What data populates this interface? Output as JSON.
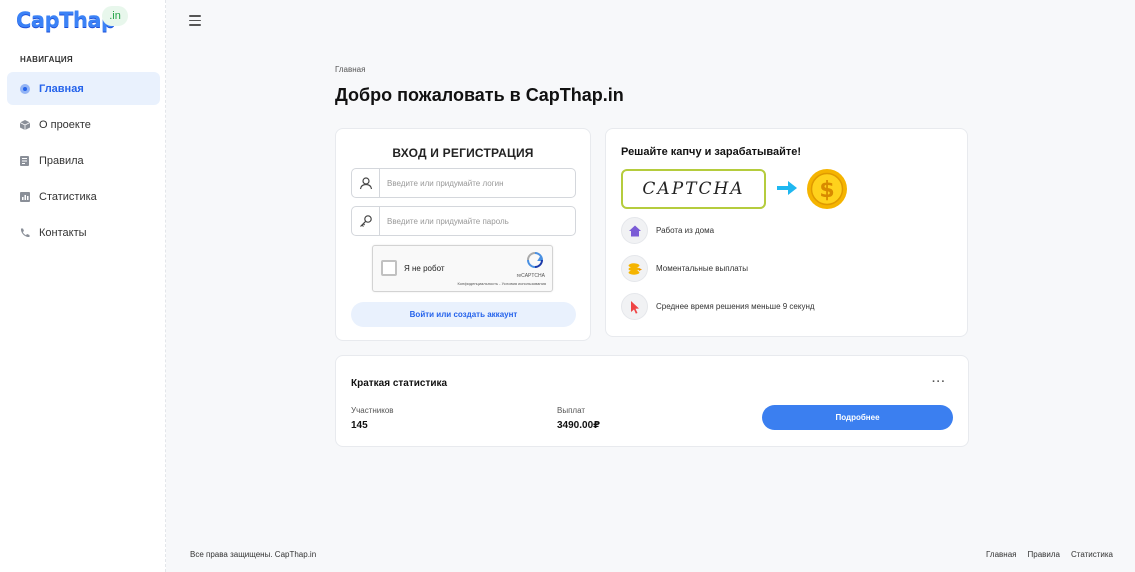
{
  "brand": {
    "name": "CapThap",
    "badge": ".in"
  },
  "sidebar": {
    "title": "НАВИГАЦИЯ",
    "items": [
      {
        "label": "Главная",
        "icon": "home-icon",
        "active": true
      },
      {
        "label": "О проекте",
        "icon": "cube-icon"
      },
      {
        "label": "Правила",
        "icon": "rules-icon"
      },
      {
        "label": "Статистика",
        "icon": "chart-icon"
      },
      {
        "label": "Контакты",
        "icon": "phone-icon"
      }
    ]
  },
  "breadcrumb": "Главная",
  "page_title": "Добро пожаловать в CapThap.in",
  "login": {
    "title": "ВХОД И РЕГИСТРАЦИЯ",
    "login_placeholder": "Введите или придумайте логин",
    "password_placeholder": "Введите или придумайте пароль",
    "recaptcha_label": "Я не робот",
    "recaptcha_brand": "reCAPTCHA",
    "recaptcha_links": "Конфиденциальность - Условия использования",
    "submit": "Войти или создать аккаунт"
  },
  "promo": {
    "title": "Решайте капчу и зарабатывайте!",
    "captcha_text": "CAPTCHA",
    "features": [
      {
        "label": "Работа из дома",
        "icon": "house-icon"
      },
      {
        "label": "Моментальные выплаты",
        "icon": "coins-icon"
      },
      {
        "label": "Среднее время решения меньше 9 секунд",
        "icon": "cursor-icon"
      }
    ]
  },
  "stats": {
    "title": "Краткая статистика",
    "participants_label": "Участников",
    "participants_value": "145",
    "payout_label": "Выплат",
    "payout_value": "3490.00₽",
    "more_button": "Подробнее"
  },
  "footer": {
    "copyright": "Все права защищены. CapThap.in",
    "links": [
      "Главная",
      "Правила",
      "Статистика"
    ]
  },
  "colors": {
    "accent": "#3b7ff0",
    "accent_light": "#e9f1fd",
    "badge_green": "#22a447"
  }
}
